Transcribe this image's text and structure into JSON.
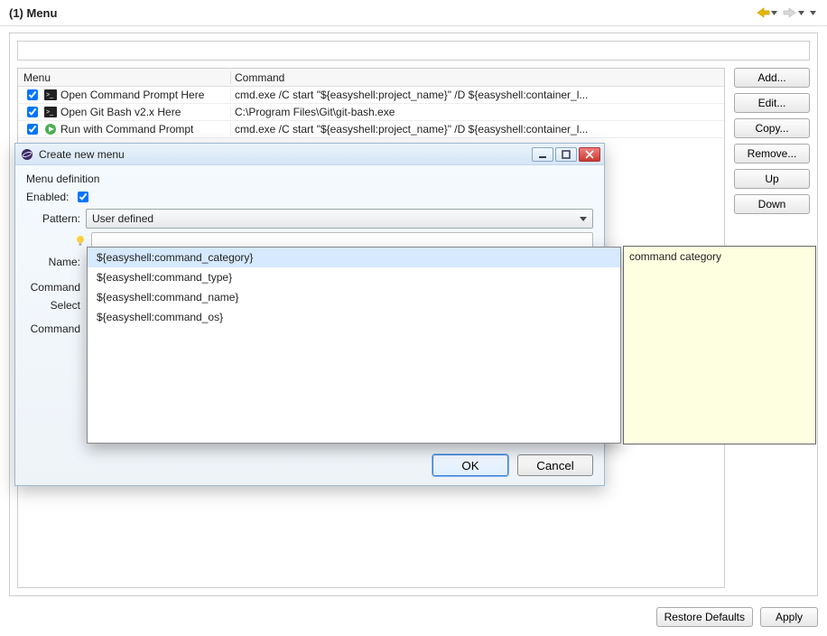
{
  "header": {
    "title": "(1) Menu"
  },
  "table": {
    "headers": {
      "menu": "Menu",
      "command": "Command"
    },
    "rows": [
      {
        "checked": true,
        "icon": "terminal",
        "menu": "Open Command Prompt Here",
        "command": "cmd.exe /C start \"${easyshell:project_name}\" /D ${easyshell:container_l..."
      },
      {
        "checked": true,
        "icon": "terminal",
        "menu": "Open Git Bash v2.x Here",
        "command": "C:\\Program Files\\Git\\git-bash.exe"
      },
      {
        "checked": true,
        "icon": "run",
        "menu": "Run with Command Prompt",
        "command": "cmd.exe /C start \"${easyshell:project_name}\" /D ${easyshell:container_l..."
      }
    ]
  },
  "sideButtons": {
    "add": "Add...",
    "edit": "Edit...",
    "copy": "Copy...",
    "remove": "Remove...",
    "up": "Up",
    "down": "Down"
  },
  "footer": {
    "restore": "Restore Defaults",
    "apply": "Apply"
  },
  "dialog": {
    "title": "Create new menu",
    "sectionLabel": "Menu definition",
    "enabledLabel": "Enabled:",
    "enabledChecked": true,
    "patternLabel": "Pattern:",
    "patternValue": "User defined",
    "patternInputValue": "",
    "nameLabel": "Name:",
    "commandLabel": "Command",
    "selectLabel": "Select",
    "commandLabel2": "Command",
    "ok": "OK",
    "cancel": "Cancel"
  },
  "autocomplete": {
    "items": [
      "${easyshell:command_category}",
      "${easyshell:command_type}",
      "${easyshell:command_name}",
      "${easyshell:command_os}"
    ],
    "selectedIndex": 0
  },
  "tooltip": {
    "text": "command category"
  }
}
